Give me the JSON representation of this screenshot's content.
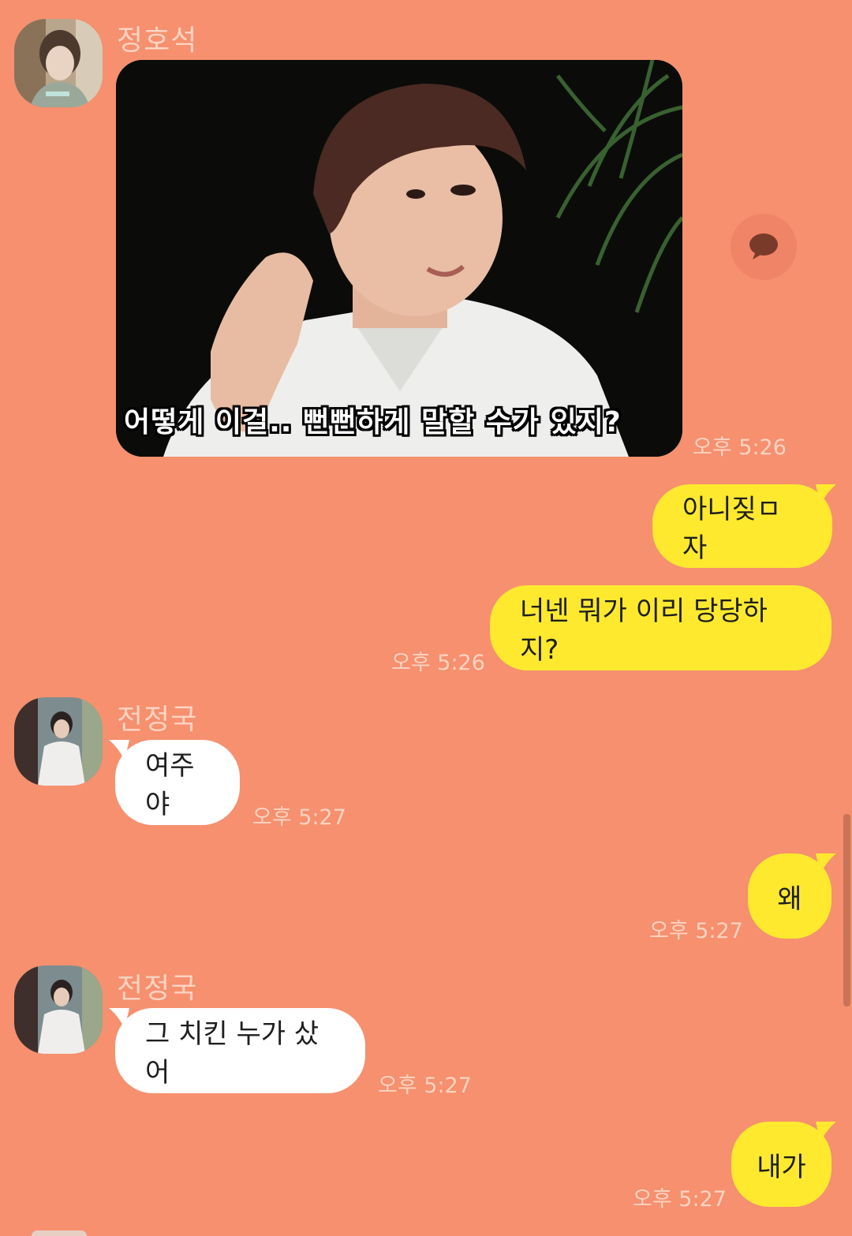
{
  "colors": {
    "background": "#F6906E",
    "my_bubble": "#FEE92F",
    "their_bubble": "#FFFFFF",
    "muted_text": "#FBD3C3"
  },
  "messages": [
    {
      "sender": "정호석",
      "type": "image",
      "caption": "어떻게 이걸.. 뻔뻔하게 말할 수가 있지?",
      "time": "오후 5:26",
      "share_icon": "chat-bubble-icon"
    },
    {
      "sender": "me",
      "text": "아니짖ㅁ자"
    },
    {
      "sender": "me",
      "text": "너넨 뭐가 이리 당당하지?",
      "time": "오후 5:26"
    },
    {
      "sender": "전정국",
      "text": "여주야",
      "time": "오후 5:27"
    },
    {
      "sender": "me",
      "text": "왜",
      "time": "오후 5:27"
    },
    {
      "sender": "전정국",
      "text": "그 치킨 누가 샀어",
      "time": "오후 5:27"
    },
    {
      "sender": "me",
      "text": "내가",
      "time": "오후 5:27"
    }
  ]
}
